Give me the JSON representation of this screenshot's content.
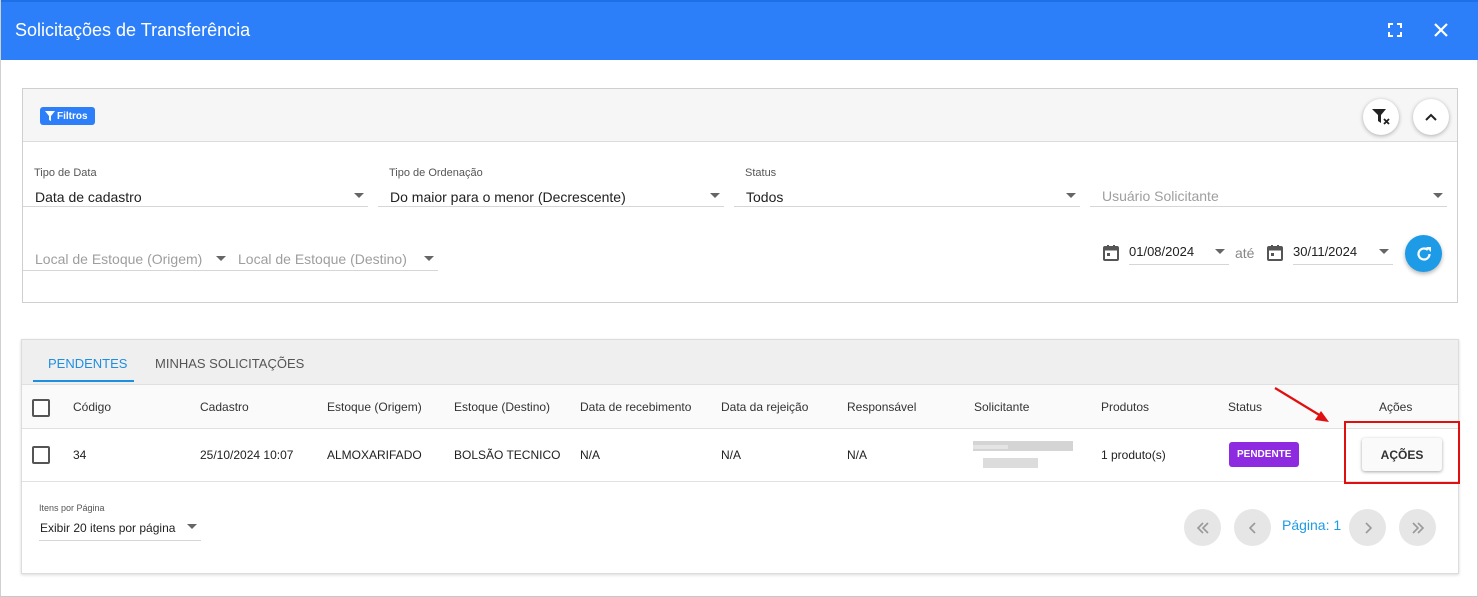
{
  "window": {
    "title": "Solicitações de Transferência",
    "header_color": "#2d7ff9"
  },
  "filters": {
    "chip_label": "Filtros",
    "tipo_data": {
      "label": "Tipo de Data",
      "value": "Data de cadastro"
    },
    "tipo_ordenacao": {
      "label": "Tipo de Ordenação",
      "value": "Do maior para o menor (Decrescente)"
    },
    "status": {
      "label": "Status",
      "value": "Todos"
    },
    "usuario_solicitante": {
      "placeholder": "Usuário Solicitante"
    },
    "local_origem": {
      "placeholder": "Local de Estoque (Origem)"
    },
    "local_destino": {
      "placeholder": "Local de Estoque (Destino)"
    },
    "date_from": "01/08/2024",
    "date_sep": "até",
    "date_to": "30/11/2024"
  },
  "tabs": [
    {
      "label": "PENDENTES",
      "active": true
    },
    {
      "label": "MINHAS SOLICITAÇÕES",
      "active": false
    }
  ],
  "table": {
    "columns": [
      "Código",
      "Cadastro",
      "Estoque (Origem)",
      "Estoque (Destino)",
      "Data de recebimento",
      "Data da rejeição",
      "Responsável",
      "Solicitante",
      "Produtos",
      "Status",
      "Ações"
    ],
    "rows": [
      {
        "codigo": "34",
        "cadastro": "25/10/2024 10:07",
        "origem": "ALMOXARIFADO",
        "destino": "BOLSÃO TECNICO",
        "recebimento": "N/A",
        "rejeicao": "N/A",
        "responsavel": "N/A",
        "produtos": "1 produto(s)",
        "status": "PENDENTE",
        "status_color": "#8e2ae0",
        "acoes_label": "AÇÕES"
      }
    ]
  },
  "pagination": {
    "per_page_label": "Itens por Página",
    "per_page_value": "Exibir 20 itens por página",
    "page_label": "Página: 1"
  }
}
